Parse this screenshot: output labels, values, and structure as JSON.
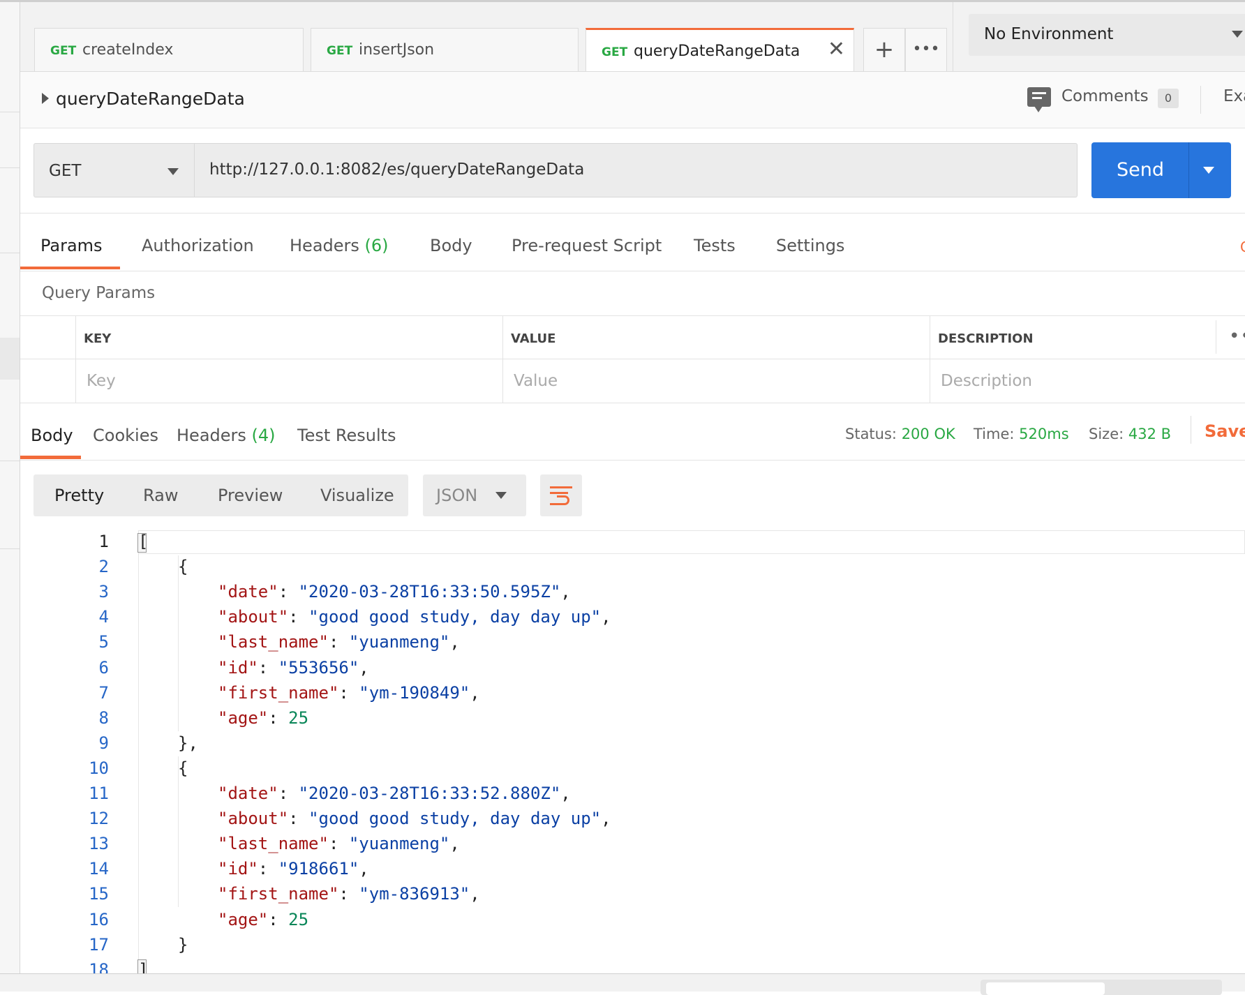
{
  "tabs": [
    {
      "method": "GET",
      "name": "createIndex"
    },
    {
      "method": "GET",
      "name": "insertJson"
    },
    {
      "method": "GET",
      "name": "queryDateRangeData"
    }
  ],
  "tab_actions": {
    "add": "+",
    "more": "•••",
    "close": "✕"
  },
  "environment": {
    "selected": "No Environment"
  },
  "request": {
    "name": "queryDateRangeData",
    "comments_label": "Comments",
    "comments_count": "0",
    "examples_label": "Exa",
    "method": "GET",
    "url": "http://127.0.0.1:8082/es/queryDateRangeData",
    "send_label": "Send"
  },
  "request_tabs": [
    {
      "label": "Params"
    },
    {
      "label": "Authorization"
    },
    {
      "label": "Headers",
      "count": "(6)"
    },
    {
      "label": "Body"
    },
    {
      "label": "Pre-request Script"
    },
    {
      "label": "Tests"
    },
    {
      "label": "Settings"
    }
  ],
  "cookies_link": "C",
  "query_params": {
    "title": "Query Params",
    "headers": {
      "key": "KEY",
      "value": "VALUE",
      "description": "DESCRIPTION"
    },
    "placeholders": {
      "key": "Key",
      "value": "Value",
      "description": "Description"
    },
    "more": "••"
  },
  "response_tabs": [
    {
      "label": "Body"
    },
    {
      "label": "Cookies"
    },
    {
      "label": "Headers",
      "count": "(4)"
    },
    {
      "label": "Test Results"
    }
  ],
  "response_status": {
    "status_label": "Status:",
    "status_value": "200 OK",
    "time_label": "Time:",
    "time_value": "520ms",
    "size_label": "Size:",
    "size_value": "432 B",
    "save_label": "Save"
  },
  "view_modes": [
    "Pretty",
    "Raw",
    "Preview",
    "Visualize"
  ],
  "format": "JSON",
  "code_lines": [
    {
      "n": "1",
      "indent": 0,
      "tokens": [
        [
          "p",
          "["
        ]
      ]
    },
    {
      "n": "2",
      "indent": 1,
      "tokens": [
        [
          "p",
          "{"
        ]
      ]
    },
    {
      "n": "3",
      "indent": 2,
      "tokens": [
        [
          "k",
          "\"date\""
        ],
        [
          "p",
          ": "
        ],
        [
          "s",
          "\"2020-03-28T16:33:50.595Z\""
        ],
        [
          "p",
          ","
        ]
      ]
    },
    {
      "n": "4",
      "indent": 2,
      "tokens": [
        [
          "k",
          "\"about\""
        ],
        [
          "p",
          ": "
        ],
        [
          "s",
          "\"good good study, day day up\""
        ],
        [
          "p",
          ","
        ]
      ]
    },
    {
      "n": "5",
      "indent": 2,
      "tokens": [
        [
          "k",
          "\"last_name\""
        ],
        [
          "p",
          ": "
        ],
        [
          "s",
          "\"yuanmeng\""
        ],
        [
          "p",
          ","
        ]
      ]
    },
    {
      "n": "6",
      "indent": 2,
      "tokens": [
        [
          "k",
          "\"id\""
        ],
        [
          "p",
          ": "
        ],
        [
          "s",
          "\"553656\""
        ],
        [
          "p",
          ","
        ]
      ]
    },
    {
      "n": "7",
      "indent": 2,
      "tokens": [
        [
          "k",
          "\"first_name\""
        ],
        [
          "p",
          ": "
        ],
        [
          "s",
          "\"ym-190849\""
        ],
        [
          "p",
          ","
        ]
      ]
    },
    {
      "n": "8",
      "indent": 2,
      "tokens": [
        [
          "k",
          "\"age\""
        ],
        [
          "p",
          ": "
        ],
        [
          "n",
          "25"
        ]
      ]
    },
    {
      "n": "9",
      "indent": 1,
      "tokens": [
        [
          "p",
          "},"
        ]
      ]
    },
    {
      "n": "10",
      "indent": 1,
      "tokens": [
        [
          "p",
          "{"
        ]
      ]
    },
    {
      "n": "11",
      "indent": 2,
      "tokens": [
        [
          "k",
          "\"date\""
        ],
        [
          "p",
          ": "
        ],
        [
          "s",
          "\"2020-03-28T16:33:52.880Z\""
        ],
        [
          "p",
          ","
        ]
      ]
    },
    {
      "n": "12",
      "indent": 2,
      "tokens": [
        [
          "k",
          "\"about\""
        ],
        [
          "p",
          ": "
        ],
        [
          "s",
          "\"good good study, day day up\""
        ],
        [
          "p",
          ","
        ]
      ]
    },
    {
      "n": "13",
      "indent": 2,
      "tokens": [
        [
          "k",
          "\"last_name\""
        ],
        [
          "p",
          ": "
        ],
        [
          "s",
          "\"yuanmeng\""
        ],
        [
          "p",
          ","
        ]
      ]
    },
    {
      "n": "14",
      "indent": 2,
      "tokens": [
        [
          "k",
          "\"id\""
        ],
        [
          "p",
          ": "
        ],
        [
          "s",
          "\"918661\""
        ],
        [
          "p",
          ","
        ]
      ]
    },
    {
      "n": "15",
      "indent": 2,
      "tokens": [
        [
          "k",
          "\"first_name\""
        ],
        [
          "p",
          ": "
        ],
        [
          "s",
          "\"ym-836913\""
        ],
        [
          "p",
          ","
        ]
      ]
    },
    {
      "n": "16",
      "indent": 2,
      "tokens": [
        [
          "k",
          "\"age\""
        ],
        [
          "p",
          ": "
        ],
        [
          "n",
          "25"
        ]
      ]
    },
    {
      "n": "17",
      "indent": 1,
      "tokens": [
        [
          "p",
          "}"
        ]
      ]
    },
    {
      "n": "18",
      "indent": 0,
      "tokens": [
        [
          "p",
          "]"
        ]
      ]
    }
  ],
  "colors": {
    "accent": "#f26b3a",
    "send_blue": "#2775dd",
    "method_green": "#29a843",
    "json_key": "#a31515",
    "json_string": "#0b40a4",
    "json_number": "#098658",
    "line_number": "#2666c7"
  },
  "icons": {
    "comments": "comment-icon",
    "wrap": "wrap-lines-icon",
    "dropdown": "chevron-down-icon",
    "expand": "caret-right-icon"
  }
}
